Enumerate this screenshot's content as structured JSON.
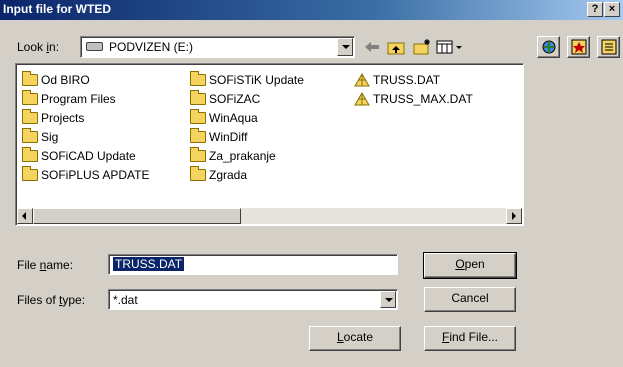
{
  "window": {
    "title": "Input file for WTED",
    "help_label": "?",
    "close_label": "×"
  },
  "lookin": {
    "label_pre": "Look ",
    "label_key": "i",
    "label_post": "n:",
    "value": "PODVIZEN (E:)"
  },
  "files": {
    "col1": [
      "Od BIRO",
      "Program Files",
      "Projects",
      "Sig",
      "SOFiCAD Update",
      "SOFiPLUS APDATE"
    ],
    "col2": [
      "SOFiSTiK Update",
      "SOFiZAC",
      "WinAqua",
      "WinDiff",
      "Za_prakanje",
      "Zgrada"
    ],
    "col3": [
      "TRUSS.DAT",
      "TRUSS_MAX.DAT"
    ]
  },
  "filename": {
    "label_pre": "File ",
    "label_key": "n",
    "label_post": "ame:",
    "value": "TRUSS.DAT"
  },
  "filetype": {
    "label_pre": "Files of ",
    "label_key": "t",
    "label_post": "ype:",
    "value": "*.dat"
  },
  "buttons": {
    "open_key": "O",
    "open_rest": "pen",
    "cancel": "Cancel",
    "locate_key": "L",
    "locate_rest": "ocate",
    "find_key": "F",
    "find_rest": "ind File..."
  },
  "colors": {
    "title_start": "#0a246a",
    "title_end": "#a6caf0",
    "selection": "#0a246a",
    "folder": "#f4d35e"
  }
}
